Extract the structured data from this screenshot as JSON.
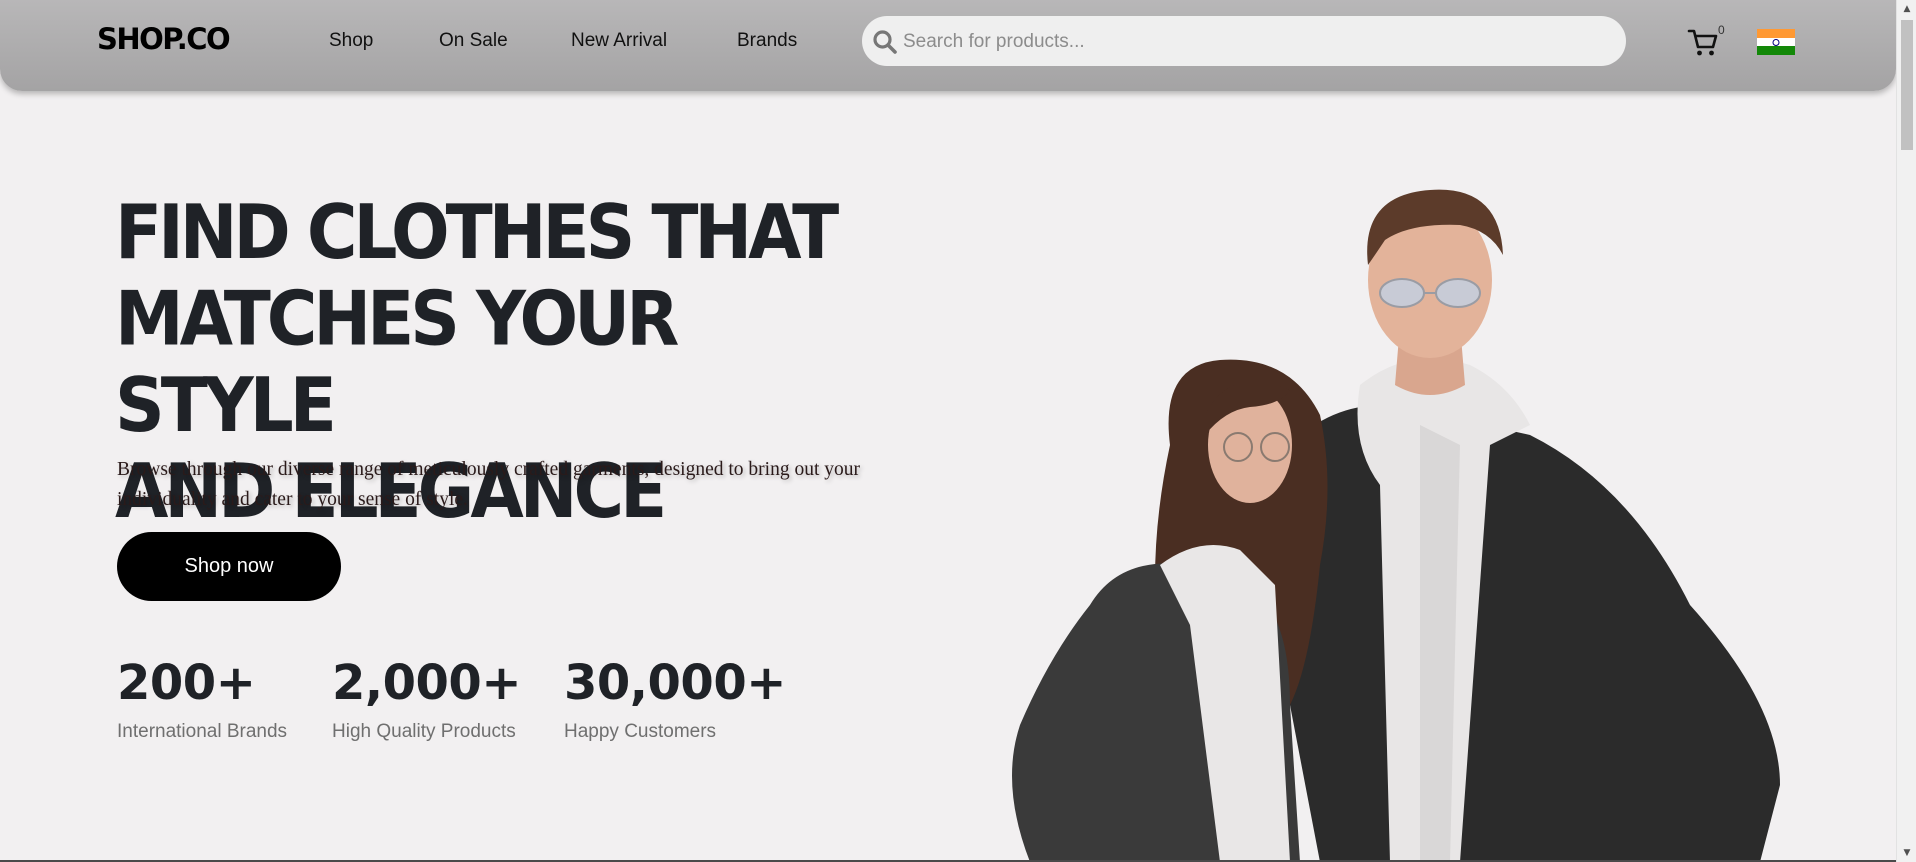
{
  "header": {
    "logo": "SHOP.CO",
    "nav": [
      "Shop",
      "On Sale",
      "New Arrival",
      "Brands"
    ],
    "search_placeholder": "Search for products...",
    "cart_count": "0",
    "icons": {
      "search": "search-icon",
      "cart": "cart-icon",
      "flag": "india-flag-icon"
    }
  },
  "hero": {
    "title_lines": [
      "FIND CLOTHES THAT",
      "MATCHES YOUR STYLE",
      "AND ELEGANCE"
    ],
    "description": "Browse through our diverse range of meticulously crafted garments, designed to bring out your individuality and cater to your sense of style.",
    "cta": "Shop now"
  },
  "stats": [
    {
      "value": "200+",
      "label": "International Brands"
    },
    {
      "value": "2,000+",
      "label": "High Quality Products"
    },
    {
      "value": "30,000+",
      "label": "Happy Customers"
    }
  ],
  "colors": {
    "header": "#a9a8a9",
    "background": "#f2f0f1",
    "text": "#1f2227",
    "button": "#000000"
  }
}
